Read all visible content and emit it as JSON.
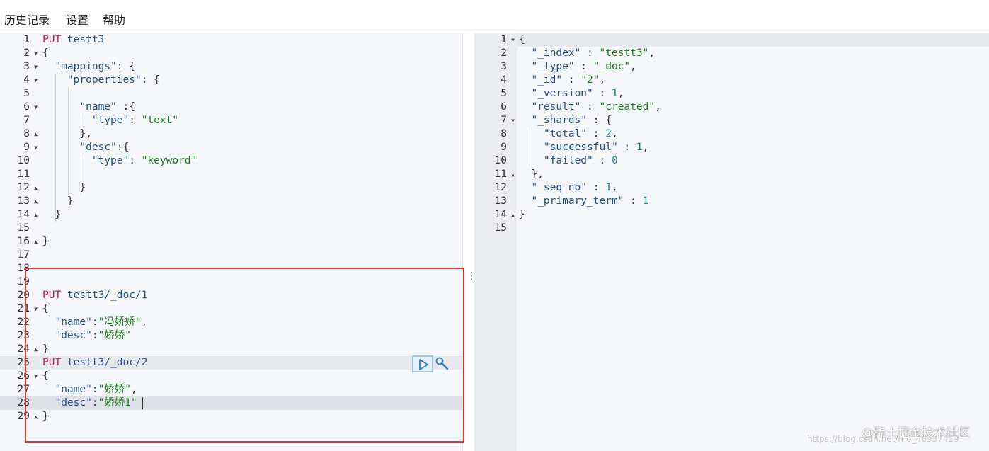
{
  "menu": {
    "history": "历史记录",
    "settings": "设置",
    "help": "帮助"
  },
  "request_editor": {
    "lines": [
      {
        "n": "1",
        "tokens": [
          {
            "t": "PUT",
            "c": "m"
          },
          {
            "t": " testt3",
            "c": "u"
          }
        ]
      },
      {
        "n": "2",
        "fold": "down",
        "tokens": [
          {
            "t": "{",
            "c": "p"
          }
        ]
      },
      {
        "n": "3",
        "fold": "down",
        "tokens": [
          {
            "t": "  \"mappings\"",
            "c": "k"
          },
          {
            "t": ": {",
            "c": "p"
          }
        ]
      },
      {
        "n": "4",
        "fold": "down",
        "tokens": [
          {
            "t": "    \"properties\"",
            "c": "k"
          },
          {
            "t": ": {",
            "c": "p"
          }
        ]
      },
      {
        "n": "5",
        "tokens": []
      },
      {
        "n": "6",
        "fold": "down",
        "tokens": [
          {
            "t": "      \"name\"",
            "c": "k"
          },
          {
            "t": " :{",
            "c": "p"
          }
        ]
      },
      {
        "n": "7",
        "tokens": [
          {
            "t": "        \"type\"",
            "c": "k"
          },
          {
            "t": ": ",
            "c": "p"
          },
          {
            "t": "\"text\"",
            "c": "s"
          }
        ]
      },
      {
        "n": "8",
        "fold": "up",
        "tokens": [
          {
            "t": "      },",
            "c": "p"
          }
        ]
      },
      {
        "n": "9",
        "fold": "down",
        "tokens": [
          {
            "t": "      \"desc\"",
            "c": "k"
          },
          {
            "t": ":{",
            "c": "p"
          }
        ]
      },
      {
        "n": "10",
        "tokens": [
          {
            "t": "        \"type\"",
            "c": "k"
          },
          {
            "t": ": ",
            "c": "p"
          },
          {
            "t": "\"keyword\"",
            "c": "s"
          }
        ]
      },
      {
        "n": "11",
        "tokens": []
      },
      {
        "n": "12",
        "fold": "up",
        "tokens": [
          {
            "t": "      }",
            "c": "p"
          }
        ]
      },
      {
        "n": "13",
        "fold": "up",
        "tokens": [
          {
            "t": "    }",
            "c": "p"
          }
        ]
      },
      {
        "n": "14",
        "fold": "up",
        "tokens": [
          {
            "t": "  }",
            "c": "p"
          }
        ]
      },
      {
        "n": "15",
        "tokens": []
      },
      {
        "n": "16",
        "fold": "up",
        "tokens": [
          {
            "t": "}",
            "c": "p"
          }
        ]
      },
      {
        "n": "17",
        "tokens": []
      },
      {
        "n": "18",
        "tokens": []
      },
      {
        "n": "19",
        "tokens": []
      },
      {
        "n": "20",
        "tokens": [
          {
            "t": "PUT",
            "c": "m"
          },
          {
            "t": " testt3/_doc/1",
            "c": "u"
          }
        ]
      },
      {
        "n": "21",
        "fold": "down",
        "tokens": [
          {
            "t": "{",
            "c": "p"
          }
        ]
      },
      {
        "n": "22",
        "tokens": [
          {
            "t": "  \"name\"",
            "c": "k"
          },
          {
            "t": ":",
            "c": "p"
          },
          {
            "t": "\"冯娇娇\"",
            "c": "s"
          },
          {
            "t": ",",
            "c": "p"
          }
        ]
      },
      {
        "n": "23",
        "tokens": [
          {
            "t": "  \"desc\"",
            "c": "k"
          },
          {
            "t": ":",
            "c": "p"
          },
          {
            "t": "\"娇娇\"",
            "c": "s"
          }
        ]
      },
      {
        "n": "24",
        "fold": "up",
        "tokens": [
          {
            "t": "}",
            "c": "p"
          }
        ]
      },
      {
        "n": "25",
        "tokens": [
          {
            "t": "PUT",
            "c": "m"
          },
          {
            "t": " testt3/_doc/2",
            "c": "u"
          }
        ]
      },
      {
        "n": "26",
        "fold": "down",
        "tokens": [
          {
            "t": "{",
            "c": "p"
          }
        ]
      },
      {
        "n": "27",
        "tokens": [
          {
            "t": "  \"name\"",
            "c": "k"
          },
          {
            "t": ":",
            "c": "p"
          },
          {
            "t": "\"娇娇\"",
            "c": "s"
          },
          {
            "t": ",",
            "c": "p"
          }
        ]
      },
      {
        "n": "28",
        "tokens": [
          {
            "t": "  \"desc\"",
            "c": "k"
          },
          {
            "t": ":",
            "c": "p"
          },
          {
            "t": "\"娇娇1\"",
            "c": "s"
          }
        ]
      },
      {
        "n": "29",
        "fold": "up",
        "tokens": [
          {
            "t": "}",
            "c": "p"
          }
        ]
      }
    ]
  },
  "response_editor": {
    "lines": [
      {
        "n": "1",
        "fold": "down",
        "tokens": [
          {
            "t": "{",
            "c": "p"
          }
        ]
      },
      {
        "n": "2",
        "tokens": [
          {
            "t": "  \"_index\"",
            "c": "k"
          },
          {
            "t": " : ",
            "c": "p"
          },
          {
            "t": "\"testt3\"",
            "c": "s"
          },
          {
            "t": ",",
            "c": "p"
          }
        ]
      },
      {
        "n": "3",
        "tokens": [
          {
            "t": "  \"_type\"",
            "c": "k"
          },
          {
            "t": " : ",
            "c": "p"
          },
          {
            "t": "\"_doc\"",
            "c": "s"
          },
          {
            "t": ",",
            "c": "p"
          }
        ]
      },
      {
        "n": "4",
        "tokens": [
          {
            "t": "  \"_id\"",
            "c": "k"
          },
          {
            "t": " : ",
            "c": "p"
          },
          {
            "t": "\"2\"",
            "c": "s"
          },
          {
            "t": ",",
            "c": "p"
          }
        ]
      },
      {
        "n": "5",
        "tokens": [
          {
            "t": "  \"_version\"",
            "c": "k"
          },
          {
            "t": " : ",
            "c": "p"
          },
          {
            "t": "1",
            "c": "n"
          },
          {
            "t": ",",
            "c": "p"
          }
        ]
      },
      {
        "n": "6",
        "tokens": [
          {
            "t": "  \"result\"",
            "c": "k"
          },
          {
            "t": " : ",
            "c": "p"
          },
          {
            "t": "\"created\"",
            "c": "s"
          },
          {
            "t": ",",
            "c": "p"
          }
        ]
      },
      {
        "n": "7",
        "fold": "down",
        "tokens": [
          {
            "t": "  \"_shards\"",
            "c": "k"
          },
          {
            "t": " : {",
            "c": "p"
          }
        ]
      },
      {
        "n": "8",
        "tokens": [
          {
            "t": "    \"total\"",
            "c": "k"
          },
          {
            "t": " : ",
            "c": "p"
          },
          {
            "t": "2",
            "c": "n"
          },
          {
            "t": ",",
            "c": "p"
          }
        ]
      },
      {
        "n": "9",
        "tokens": [
          {
            "t": "    \"successful\"",
            "c": "k"
          },
          {
            "t": " : ",
            "c": "p"
          },
          {
            "t": "1",
            "c": "n"
          },
          {
            "t": ",",
            "c": "p"
          }
        ]
      },
      {
        "n": "10",
        "tokens": [
          {
            "t": "    \"failed\"",
            "c": "k"
          },
          {
            "t": " : ",
            "c": "p"
          },
          {
            "t": "0",
            "c": "n"
          }
        ]
      },
      {
        "n": "11",
        "fold": "up",
        "tokens": [
          {
            "t": "  },",
            "c": "p"
          }
        ]
      },
      {
        "n": "12",
        "tokens": [
          {
            "t": "  \"_seq_no\"",
            "c": "k"
          },
          {
            "t": " : ",
            "c": "p"
          },
          {
            "t": "1",
            "c": "n"
          },
          {
            "t": ",",
            "c": "p"
          }
        ]
      },
      {
        "n": "13",
        "tokens": [
          {
            "t": "  \"_primary_term\"",
            "c": "k"
          },
          {
            "t": " : ",
            "c": "p"
          },
          {
            "t": "1",
            "c": "n"
          }
        ]
      },
      {
        "n": "14",
        "fold": "up",
        "tokens": [
          {
            "t": "}",
            "c": "p"
          }
        ]
      },
      {
        "n": "15",
        "tokens": []
      }
    ]
  },
  "watermark": {
    "brand": "@稀土掘金技术社区",
    "url": "https://blog.csdn.net/m0_46937429"
  },
  "colors": {
    "method": "#c2185b",
    "url": "#23508a",
    "key": "#23508a",
    "string": "#1a7f1a",
    "number": "#1f8a8a",
    "selection_box": "#e53935",
    "run_button_border": "#9fc3e6"
  },
  "icons": {
    "run": "play-icon",
    "settings": "wrench-icon",
    "fold_open": "fold-down-icon",
    "fold_closed": "fold-up-icon"
  }
}
